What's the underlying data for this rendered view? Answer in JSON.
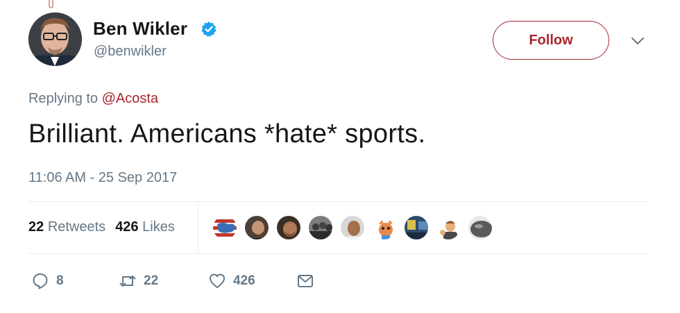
{
  "author": {
    "display_name": "Ben Wikler",
    "handle": "@benwikler",
    "verified": true,
    "verified_icon": "verified-badge-icon"
  },
  "follow_label": "Follow",
  "menu_icon": "chevron-down-icon",
  "replying": {
    "prefix": "Replying to",
    "mention": "@Acosta"
  },
  "tweet_text": "Brilliant. Americans *hate* sports.",
  "timestamp": "11:06 AM - 25 Sep 2017",
  "stats": {
    "retweets_count": "22",
    "retweets_label": "Retweets",
    "likes_count": "426",
    "likes_label": "Likes"
  },
  "actions": {
    "reply_count": "8",
    "retweet_count": "22",
    "like_count": "426"
  },
  "colors": {
    "accent": "#a8262c",
    "muted": "#657786",
    "text": "#14171a",
    "verified": "#1da1f2"
  }
}
